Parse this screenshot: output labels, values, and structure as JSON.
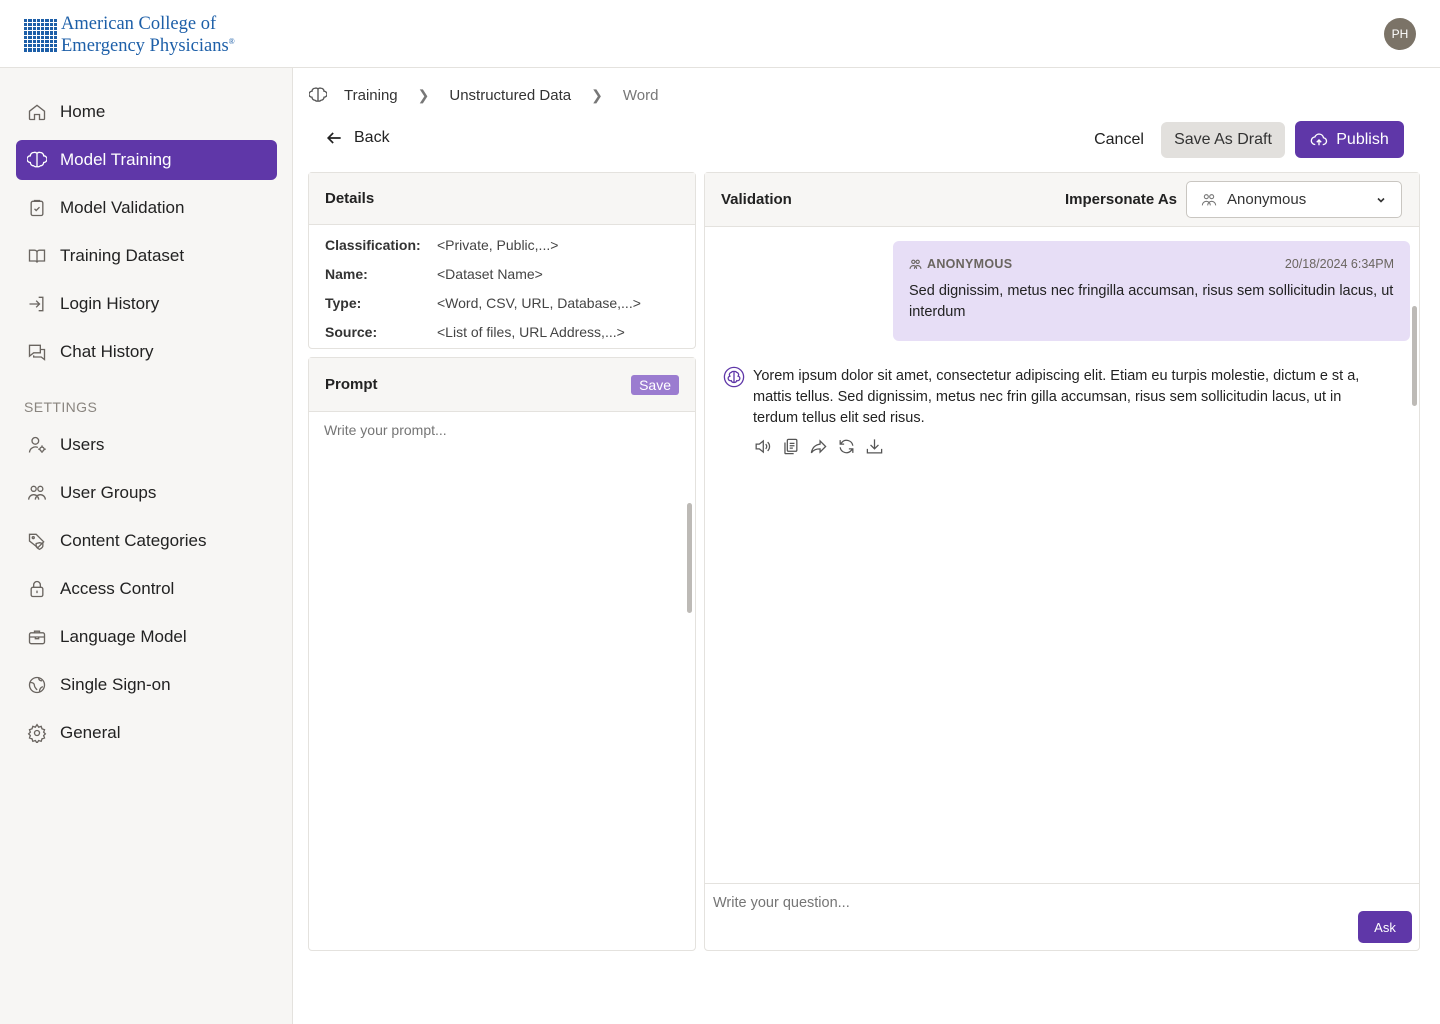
{
  "header": {
    "logo_line1": "American College of",
    "logo_line2": "Emergency Physicians",
    "logo_mark": "®",
    "avatar_initials": "PH"
  },
  "sidebar": {
    "items": [
      {
        "label": "Home",
        "icon": "home-icon",
        "active": false
      },
      {
        "label": "Model Training",
        "icon": "brain-icon",
        "active": true
      },
      {
        "label": "Model Validation",
        "icon": "clipboard-check-icon",
        "active": false
      },
      {
        "label": "Training Dataset",
        "icon": "book-open-icon",
        "active": false
      },
      {
        "label": "Login History",
        "icon": "login-icon",
        "active": false
      },
      {
        "label": "Chat History",
        "icon": "chat-icon",
        "active": false
      }
    ],
    "settings_label": "SETTINGS",
    "settings_items": [
      {
        "label": "Users",
        "icon": "user-gear-icon"
      },
      {
        "label": "User Groups",
        "icon": "users-icon"
      },
      {
        "label": "Content Categories",
        "icon": "tag-shield-icon"
      },
      {
        "label": "Access Control",
        "icon": "lock-icon"
      },
      {
        "label": "Language Model",
        "icon": "briefcase-icon"
      },
      {
        "label": "Single Sign-on",
        "icon": "globe-icon"
      },
      {
        "label": "General",
        "icon": "gear-icon"
      }
    ]
  },
  "breadcrumb": {
    "items": [
      "Training",
      "Unstructured Data",
      "Word"
    ]
  },
  "toolbar": {
    "back_label": "Back",
    "cancel_label": "Cancel",
    "draft_label": "Save As Draft",
    "publish_label": "Publish"
  },
  "details": {
    "title": "Details",
    "rows": [
      {
        "key": "Classification:",
        "value": "<Private, Public,...>"
      },
      {
        "key": "Name:",
        "value": "<Dataset Name>"
      },
      {
        "key": "Type:",
        "value": "<Word, CSV, URL, Database,...>"
      },
      {
        "key": "Source:",
        "value": "<List of files, URL Address,...>"
      }
    ]
  },
  "prompt": {
    "title": "Prompt",
    "save_label": "Save",
    "placeholder": "Write your prompt..."
  },
  "validation": {
    "title": "Validation",
    "impersonate_label": "Impersonate As",
    "impersonate_value": "Anonymous",
    "user_message": {
      "sender": "ANONYMOUS",
      "timestamp": "20/18/2024 6:34PM",
      "text": "Sed dignissim, metus nec fringilla accumsan, risus sem sollicitudin lacus, ut interdum"
    },
    "bot_message": {
      "text": "Yorem ipsum dolor sit amet, consectetur adipiscing elit. Etiam eu turpis molestie, dictum e st a, mattis tellus. Sed dignissim, metus nec frin gilla accumsan, risus sem sollicitudin lacus, ut in terdum tellus elit sed risus."
    },
    "ask_placeholder": "Write your question...",
    "ask_label": "Ask"
  },
  "colors": {
    "accent": "#5f37a8",
    "user_bubble": "#e7def6",
    "brand_blue": "#1d5fa8"
  }
}
